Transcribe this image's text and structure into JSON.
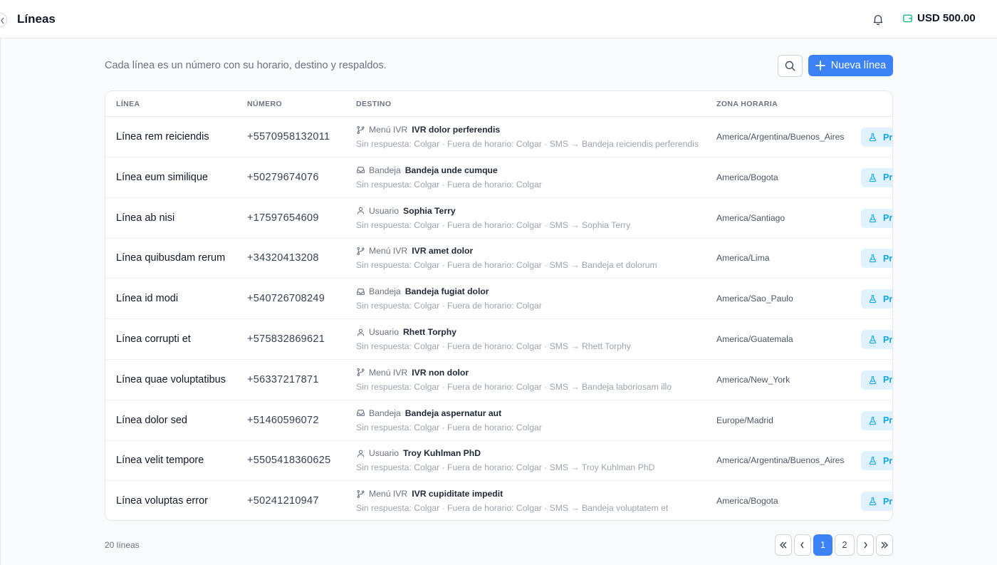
{
  "header": {
    "title": "Líneas",
    "balance": "USD 500.00"
  },
  "toolbar": {
    "description": "Cada línea es un número con su horario, destino y respaldos.",
    "new_label": "Nueva línea"
  },
  "table": {
    "columns": [
      "LÍNEA",
      "NÚMERO",
      "DESTINO",
      "ZONA HORARIA"
    ],
    "test_label": "Pro",
    "rows": [
      {
        "name": "Línea rem reiciendis",
        "number": "+5570958132011",
        "dest_icon": "branch-icon",
        "dest_type": "Menú IVR",
        "dest_name": "IVR dolor perferendis",
        "fallback": "Sin respuesta: Colgar · Fuera de horario: Colgar · SMS → Bandeja reiciendis perferendis",
        "timezone": "America/Argentina/Buenos_Aires"
      },
      {
        "name": "Línea eum similique",
        "number": "+50279674076",
        "dest_icon": "inbox-icon",
        "dest_type": "Bandeja",
        "dest_name": "Bandeja unde cumque",
        "fallback": "Sin respuesta: Colgar · Fuera de horario: Colgar",
        "timezone": "America/Bogota"
      },
      {
        "name": "Línea ab nisi",
        "number": "+17597654609",
        "dest_icon": "user-icon",
        "dest_type": "Usuario",
        "dest_name": "Sophia Terry",
        "fallback": "Sin respuesta: Colgar · Fuera de horario: Colgar · SMS → Sophia Terry",
        "timezone": "America/Santiago"
      },
      {
        "name": "Línea quibusdam rerum",
        "number": "+34320413208",
        "dest_icon": "branch-icon",
        "dest_type": "Menú IVR",
        "dest_name": "IVR amet dolor",
        "fallback": "Sin respuesta: Colgar · Fuera de horario: Colgar · SMS → Bandeja et dolorum",
        "timezone": "America/Lima"
      },
      {
        "name": "Línea id modi",
        "number": "+540726708249",
        "dest_icon": "inbox-icon",
        "dest_type": "Bandeja",
        "dest_name": "Bandeja fugiat dolor",
        "fallback": "Sin respuesta: Colgar · Fuera de horario: Colgar",
        "timezone": "America/Sao_Paulo"
      },
      {
        "name": "Línea corrupti et",
        "number": "+575832869621",
        "dest_icon": "user-icon",
        "dest_type": "Usuario",
        "dest_name": "Rhett Torphy",
        "fallback": "Sin respuesta: Colgar · Fuera de horario: Colgar · SMS → Rhett Torphy",
        "timezone": "America/Guatemala"
      },
      {
        "name": "Línea quae voluptatibus",
        "number": "+56337217871",
        "dest_icon": "branch-icon",
        "dest_type": "Menú IVR",
        "dest_name": "IVR non dolor",
        "fallback": "Sin respuesta: Colgar · Fuera de horario: Colgar · SMS → Bandeja laboriosam illo",
        "timezone": "America/New_York"
      },
      {
        "name": "Línea dolor sed",
        "number": "+51460596072",
        "dest_icon": "inbox-icon",
        "dest_type": "Bandeja",
        "dest_name": "Bandeja aspernatur aut",
        "fallback": "Sin respuesta: Colgar · Fuera de horario: Colgar",
        "timezone": "Europe/Madrid"
      },
      {
        "name": "Línea velit tempore",
        "number": "+5505418360625",
        "dest_icon": "user-icon",
        "dest_type": "Usuario",
        "dest_name": "Troy Kuhlman PhD",
        "fallback": "Sin respuesta: Colgar · Fuera de horario: Colgar · SMS → Troy Kuhlman PhD",
        "timezone": "America/Argentina/Buenos_Aires"
      },
      {
        "name": "Línea voluptas error",
        "number": "+50241210947",
        "dest_icon": "branch-icon",
        "dest_type": "Menú IVR",
        "dest_name": "IVR cupiditate impedit",
        "fallback": "Sin respuesta: Colgar · Fuera de horario: Colgar · SMS → Bandeja voluptatem et",
        "timezone": "America/Bogota"
      }
    ]
  },
  "footer": {
    "count": "20 líneas"
  },
  "pagination": {
    "pages": [
      "1",
      "2"
    ],
    "current": "1"
  },
  "colors": {
    "primary": "#3b82f6",
    "test_bg": "#e0f2fe",
    "test_fg": "#0ea5e9",
    "wallet": "#10b981"
  }
}
